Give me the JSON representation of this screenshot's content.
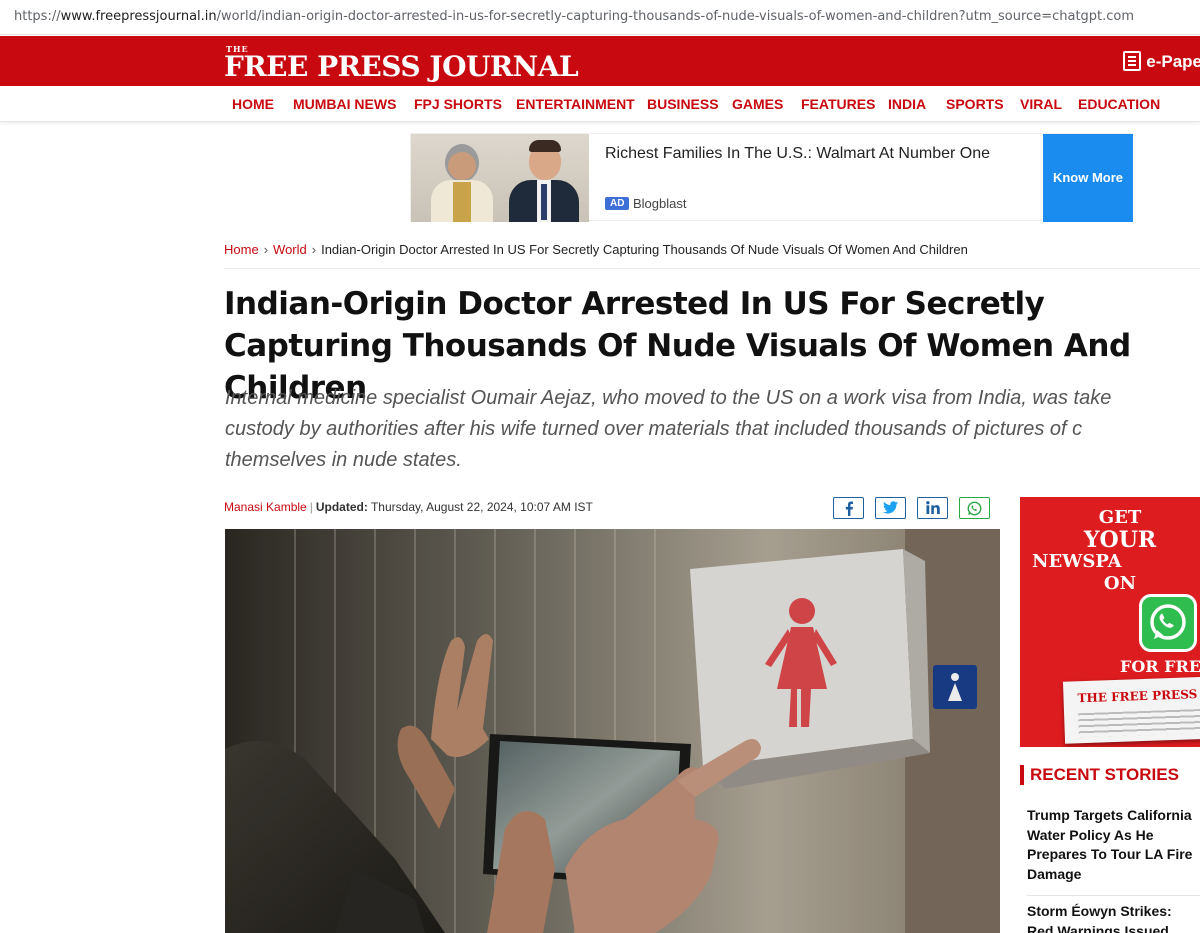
{
  "browser": {
    "url_prefix": "https://",
    "url_host": "www.freepressjournal.in",
    "url_path": "/world/indian-origin-doctor-arrested-in-us-for-secretly-capturing-thousands-of-nude-visuals-of-women-and-children?utm_source=chatgpt.com"
  },
  "masthead": {
    "logo_small": "THE",
    "logo_name": "FREE PRESS JOURNAL",
    "epaper_label": "e-Pape",
    "epaper_icon": "newspaper-icon",
    "bg_color": "#c8090f"
  },
  "nav": {
    "items": [
      "HOME",
      "MUMBAI NEWS",
      "FPJ SHORTS",
      "ENTERTAINMENT",
      "BUSINESS",
      "GAMES",
      "FEATURES",
      "INDIA",
      "SPORTS",
      "VIRAL",
      "EDUCATION"
    ]
  },
  "ad": {
    "headline": "Richest Families In The U.S.: Walmart At Number One",
    "badge": "AD",
    "source": "Blogblast",
    "cta": "Know More",
    "cta_color": "#1a8cf0"
  },
  "breadcrumb": {
    "home": "Home",
    "section": "World",
    "current": "Indian-Origin Doctor Arrested In US For Secretly Capturing Thousands Of Nude Visuals Of Women And Children"
  },
  "article": {
    "title": "Indian-Origin Doctor Arrested In US For Secretly Capturing Thousands Of Nude Visuals Of Women And Children",
    "summary_lines": [
      "Internal medicine specialist Oumair Aejaz, who moved to the US on a work visa from India, was take",
      "custody by authorities after his wife turned over materials that included thousands of pictures of c",
      "themselves in nude states."
    ],
    "author": "Manasi Kamble",
    "updated_label": "Updated:",
    "updated_value": "Thursday, August 22, 2024, 10:07 AM IST",
    "share_icons": [
      "facebook-icon",
      "twitter-icon",
      "linkedin-icon",
      "whatsapp-icon"
    ]
  },
  "sidebar": {
    "promo": {
      "lines": [
        "GET",
        "YOUR",
        "NEWSPA",
        "ON",
        "FOR FRE"
      ],
      "paper_name": "THE FREE PRESS J"
    },
    "recent_heading": "RECENT STORIES",
    "stories": [
      "Trump Targets California Water Policy As He Prepares To Tour LA Fire Damage",
      "Storm Éowyn Strikes: Red Warnings Issued"
    ]
  }
}
